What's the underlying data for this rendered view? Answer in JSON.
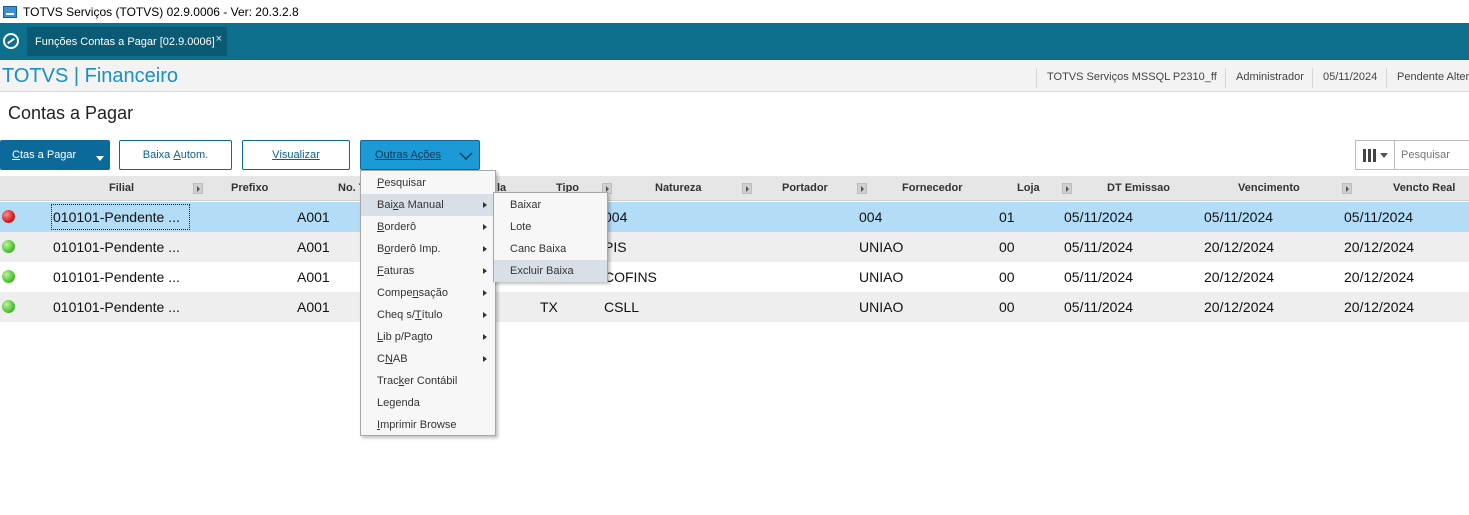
{
  "window": {
    "title": "TOTVS Serviços (TOTVS) 02.9.0006 - Ver: 20.3.2.8"
  },
  "tabbar": {
    "tab_label": "Funções Contas a Pagar [02.9.0006]",
    "close_glyph": "×"
  },
  "header": {
    "brand": "TOTVS | Financeiro",
    "environment": "TOTVS Serviços MSSQL P2310_ff",
    "user": "Administrador",
    "date": "05/11/2024",
    "branch": "Pendente Altera"
  },
  "page": {
    "title": "Contas a Pagar"
  },
  "toolbar": {
    "ctas": {
      "first": "C",
      "rest": "tas a Pagar"
    },
    "baixa": {
      "pre": "Baixa ",
      "u": "A",
      "post": "utom."
    },
    "visualizar": {
      "u": "V",
      "post": "isualizar"
    },
    "outras": {
      "u": "O",
      "post": "utras Ações"
    },
    "search_placeholder": "Pesquisar"
  },
  "grid": {
    "columns": [
      {
        "label": "Filial"
      },
      {
        "label": "Prefixo"
      },
      {
        "label": "No. T"
      },
      {
        "label": "la"
      },
      {
        "label": "Tipo"
      },
      {
        "label": "Natureza"
      },
      {
        "label": "Portador"
      },
      {
        "label": "Fornecedor"
      },
      {
        "label": "Loja"
      },
      {
        "label": "DT Emissao"
      },
      {
        "label": "Vencimento"
      },
      {
        "label": "Vencto Real"
      }
    ],
    "rows": [
      {
        "status": "red",
        "filial": "010101-Pendente ...",
        "prefixo": "A001",
        "tipo": "",
        "natureza": "004",
        "fornecedor": "004",
        "loja": "01",
        "dt_emissao": "05/11/2024",
        "vencimento": "05/11/2024",
        "vencto_real": "05/11/2024"
      },
      {
        "status": "green",
        "filial": "010101-Pendente ...",
        "prefixo": "A001",
        "tipo": "",
        "natureza": "PIS",
        "fornecedor": "UNIAO",
        "loja": "00",
        "dt_emissao": "05/11/2024",
        "vencimento": "20/12/2024",
        "vencto_real": "20/12/2024"
      },
      {
        "status": "green",
        "filial": "010101-Pendente ...",
        "prefixo": "A001",
        "tipo": "",
        "natureza": "COFINS",
        "fornecedor": "UNIAO",
        "loja": "00",
        "dt_emissao": "05/11/2024",
        "vencimento": "20/12/2024",
        "vencto_real": "20/12/2024"
      },
      {
        "status": "green",
        "filial": "010101-Pendente ...",
        "prefixo": "A001",
        "tipo": "TX",
        "natureza": "CSLL",
        "fornecedor": "UNIAO",
        "loja": "00",
        "dt_emissao": "05/11/2024",
        "vencimento": "20/12/2024",
        "vencto_real": "20/12/2024"
      }
    ]
  },
  "menu": {
    "items": [
      {
        "pre": "",
        "u": "P",
        "post": "esquisar",
        "submenu": false
      },
      {
        "pre": "Bai",
        "u": "x",
        "post": "a Manual",
        "submenu": true,
        "highlighted": true
      },
      {
        "pre": "",
        "u": "B",
        "post": "orderô",
        "submenu": true
      },
      {
        "pre": "B",
        "u": "o",
        "post": "rderô Imp.",
        "submenu": true
      },
      {
        "pre": "",
        "u": "F",
        "post": "aturas",
        "submenu": true
      },
      {
        "pre": "Compe",
        "u": "n",
        "post": "sação",
        "submenu": true
      },
      {
        "pre": "Cheq s/",
        "u": "T",
        "post": "ítulo",
        "submenu": true
      },
      {
        "pre": "",
        "u": "L",
        "post": "ib p/Pagto",
        "submenu": true
      },
      {
        "pre": "C",
        "u": "N",
        "post": "AB",
        "submenu": true
      },
      {
        "pre": "Trac",
        "u": "k",
        "post": "er Contábil",
        "submenu": false
      },
      {
        "pre": "Le",
        "u": "g",
        "post": "enda",
        "submenu": false
      },
      {
        "pre": "",
        "u": "I",
        "post": "mprimir Browse",
        "submenu": false
      }
    ],
    "submenu": [
      "Baixar",
      "Lote",
      "Canc Baixa",
      "Excluir Baixa"
    ]
  },
  "colors": {
    "teal": "#0e6f8c",
    "brand_blue": "#1a8ec9",
    "row_selected": "#b3dcf7",
    "row_alt": "#eeeeee"
  }
}
